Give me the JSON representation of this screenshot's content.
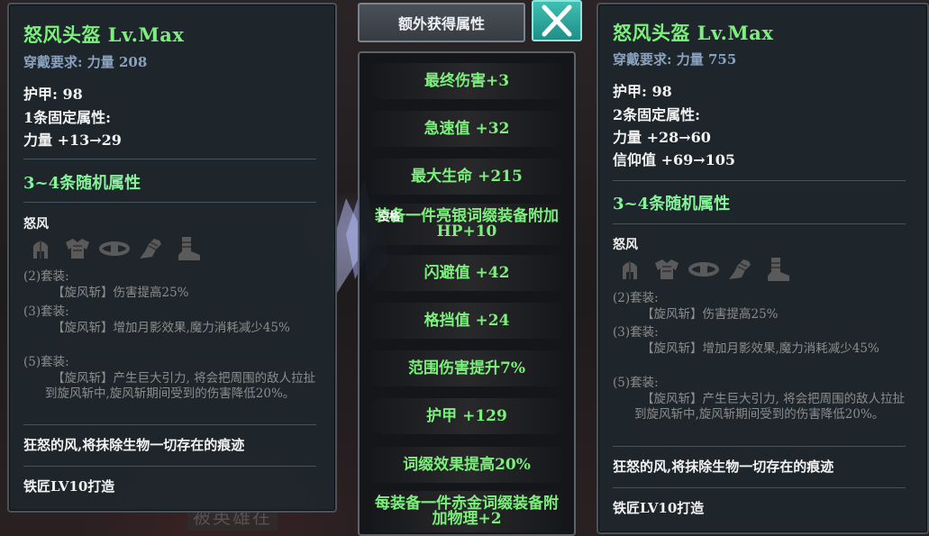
{
  "colors": {
    "name_green": "#7cf07c",
    "attr_green": "#86f39a",
    "label_blue": "#8aa3bf",
    "close_teal": "#2aa79c"
  },
  "background": {
    "text": "被英雄在"
  },
  "hint": {
    "key_label": "空格"
  },
  "left_item": {
    "title": "怒风头盔 Lv.Max",
    "requirement": "穿戴要求: 力量 208",
    "armor": "护甲:  98",
    "fixed_count": "1条固定属性:",
    "fixed_attrs": [
      "力量 +13→29"
    ],
    "random_header": "3~4条随机属性",
    "set_name": "怒风",
    "set_icons": [
      "helmet-icon",
      "chest-armor-icon",
      "belt-icon",
      "gauntlet-icon",
      "boots-icon"
    ],
    "set_bonus": {
      "b2_label": "(2)套装:",
      "b2_text": "【旋风斩】伤害提高25%",
      "b3_label": "(3)套装:",
      "b3_text": "【旋风斩】增加月影效果,魔力消耗减少45%",
      "b5_label": "(5)套装:",
      "b5_text": "【旋风斩】产生巨大引力, 将会把周围的敌人拉扯到旋风斩中,旋风斩期间受到的伤害降低20%。"
    },
    "flavor": "狂怒的风,将抹除生物一切存在的痕迹",
    "maker": "铁匠LV10打造"
  },
  "right_item": {
    "title": "怒风头盔 Lv.Max",
    "requirement": "穿戴要求: 力量 755",
    "armor": "护甲:  98",
    "fixed_count": "2条固定属性:",
    "fixed_attrs": [
      "力量 +28→60",
      "信仰值 +69→105"
    ],
    "random_header": "3~4条随机属性",
    "set_name": "怒风",
    "set_icons": [
      "helmet-icon",
      "chest-armor-icon",
      "belt-icon",
      "gauntlet-icon",
      "boots-icon"
    ],
    "set_bonus": {
      "b2_label": "(2)套装:",
      "b2_text": "【旋风斩】伤害提高25%",
      "b3_label": "(3)套装:",
      "b3_text": "【旋风斩】增加月影效果,魔力消耗减少45%",
      "b5_label": "(5)套装:",
      "b5_text": "【旋风斩】产生巨大引力, 将会把周围的敌人拉扯到旋风斩中,旋风斩期间受到的伤害降低20%。"
    },
    "flavor": "狂怒的风,将抹除生物一切存在的痕迹",
    "maker": "铁匠LV10打造"
  },
  "extra_panel": {
    "button_label": "额外获得属性",
    "close_icon": "close-x-icon",
    "attributes": [
      "最终伤害+3",
      "急速值 +32",
      "最大生命 +215",
      "装备一件亮银词缀装备附加HP+10",
      "闪避值 +42",
      "格挡值 +24",
      "范围伤害提升7%",
      "护甲 +129",
      "词缀效果提高20%",
      "每装备一件赤金词缀装备附加物理+2"
    ]
  }
}
